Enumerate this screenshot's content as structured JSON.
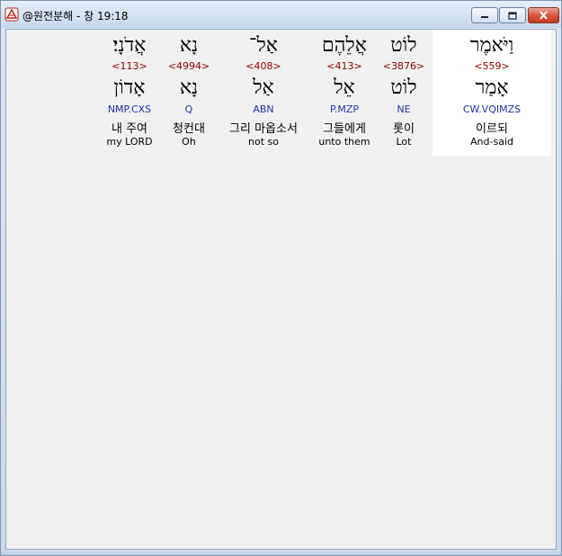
{
  "window": {
    "title": "@원전분해 - 창 19:18",
    "icon": "app-icon"
  },
  "columns": [
    {
      "hebrew": "וַיֹּאמֶר",
      "strong": "<559>",
      "lemma": "אָמַר",
      "parse": "CW.VQIMZS",
      "korean": "이르되",
      "english": "And-said",
      "selected": true
    },
    {
      "hebrew": "לוֹט",
      "strong": "<3876>",
      "lemma": "לוֹט",
      "parse": "NE",
      "korean": "롯이",
      "english": "Lot",
      "selected": false
    },
    {
      "hebrew": "אֲלֵהֶם",
      "strong": "<413>",
      "lemma": "אֵל",
      "parse": "P.MZP",
      "korean": "그들에게",
      "english": "unto them",
      "selected": false
    },
    {
      "hebrew": "אַל־",
      "strong": "<408>",
      "lemma": "אַל",
      "parse": "ABN",
      "korean": "그리 마옵소서",
      "english": "not so",
      "selected": false
    },
    {
      "hebrew": "נָא",
      "strong": "<4994>",
      "lemma": "נָא",
      "parse": "Q",
      "korean": "청컨대",
      "english": "Oh",
      "selected": false
    },
    {
      "hebrew": "אֲדֹנָי׃",
      "strong": "<113>",
      "lemma": "אָדוֹן",
      "parse": "NMP.CXS",
      "korean": "내 주여",
      "english": "my LORD",
      "selected": false
    }
  ]
}
